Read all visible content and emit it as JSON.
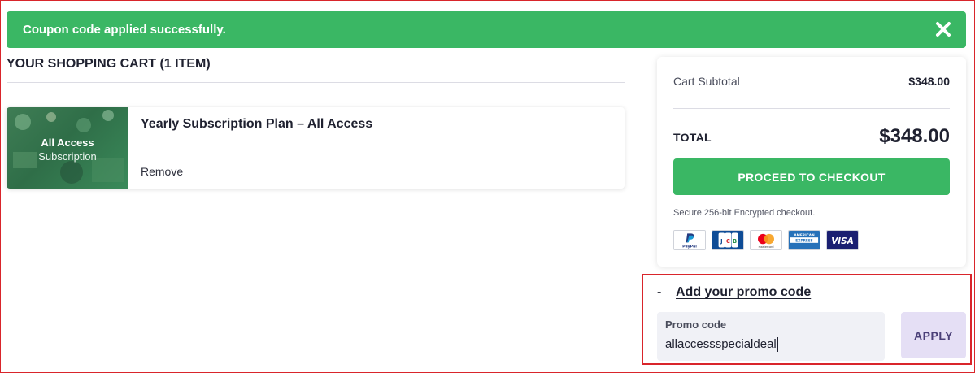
{
  "alert": {
    "message": "Coupon code applied successfully.",
    "close_icon": "close-icon"
  },
  "cart": {
    "title": "YOUR SHOPPING CART (1 ITEM)",
    "items": [
      {
        "thumb_line1": "All Access",
        "thumb_line2": "Subscription",
        "name": "Yearly Subscription Plan – All Access",
        "remove_label": "Remove"
      }
    ]
  },
  "summary": {
    "subtotal_label": "Cart Subtotal",
    "subtotal_value": "$348.00",
    "total_label": "TOTAL",
    "total_value": "$348.00",
    "checkout_label": "PROCEED TO CHECKOUT",
    "secure_text": "Secure 256-bit Encrypted checkout.",
    "payment_icons": [
      "paypal-icon",
      "jcb-icon",
      "mastercard-icon",
      "american-express-icon",
      "visa-icon"
    ]
  },
  "promo": {
    "toggle_symbol": "-",
    "link_label": "Add your promo code",
    "field_label": "Promo code",
    "field_value": "allaccessspecialdeal",
    "apply_label": "APPLY"
  },
  "colors": {
    "success_green": "#3ab764",
    "highlight_red": "#d9252b",
    "apply_bg": "#e5dff5",
    "text_dark": "#1f2130"
  }
}
